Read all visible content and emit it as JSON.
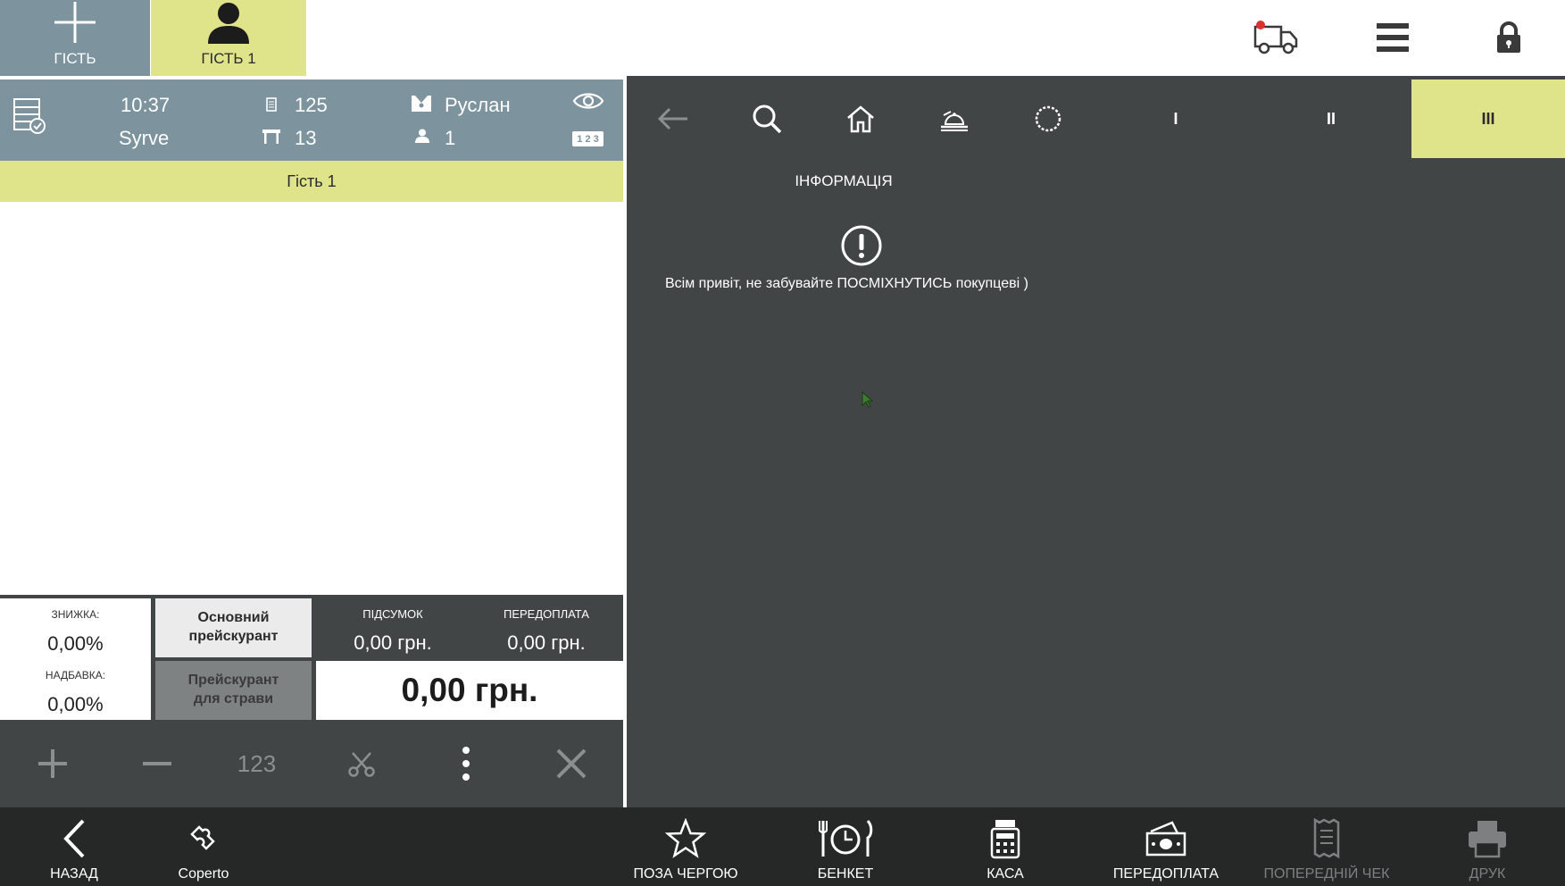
{
  "top_bar": {
    "add_guest_label": "ГІСТЬ",
    "guest_tab_label": "ГІСТЬ 1",
    "icons": [
      "delivery-truck-icon",
      "hamburger-menu-icon",
      "lock-icon"
    ]
  },
  "order_header": {
    "time": "10:37",
    "restaurant": "Syrve",
    "order_number": "125",
    "table_number": "13",
    "waiter": "Руслан",
    "guests_count": "1",
    "numbers_badge": "1 2 3"
  },
  "guest_strip": {
    "label": "Гість 1"
  },
  "summary": {
    "discount_label": "ЗНИЖКА:",
    "discount_value": "0,00%",
    "surcharge_label": "НАДБАВКА:",
    "surcharge_value": "0,00%",
    "price_list_main": "Основний прейскурант",
    "price_list_dish": "Прейскурант для страви",
    "subtotal_label": "ПІДСУМОК",
    "subtotal_value": "0,00 грн.",
    "prepayment_label": "ПЕРЕДОПЛАТА",
    "prepayment_value": "0,00 грн.",
    "total_value": "0,00 грн."
  },
  "left_toolbar": {
    "numpad_label": "123"
  },
  "right_panel": {
    "tabs": [
      "I",
      "II",
      "III"
    ],
    "active_tab": "III",
    "info_title": "ІНФОРМАЦІЯ",
    "info_message": "Всім привіт, не забувайте ПОСМІХНУТИСЬ покупцеві )"
  },
  "bottom_bar": {
    "back": "НАЗАД",
    "coperto": "Coperto",
    "out_of_turn": "ПОЗА ЧЕРГОЮ",
    "banquet": "БЕНКЕТ",
    "cash": "КАСА",
    "prepayment": "ПЕРЕДОПЛАТА",
    "preliminary_check": "ПОПЕРЕДНІЙ ЧЕК",
    "print": "ДРУК"
  },
  "colors": {
    "accent_yellow": "#dfe38a",
    "header_gray": "#7d939d",
    "panel_dark": "#424545",
    "bottom_dark": "#262828"
  }
}
